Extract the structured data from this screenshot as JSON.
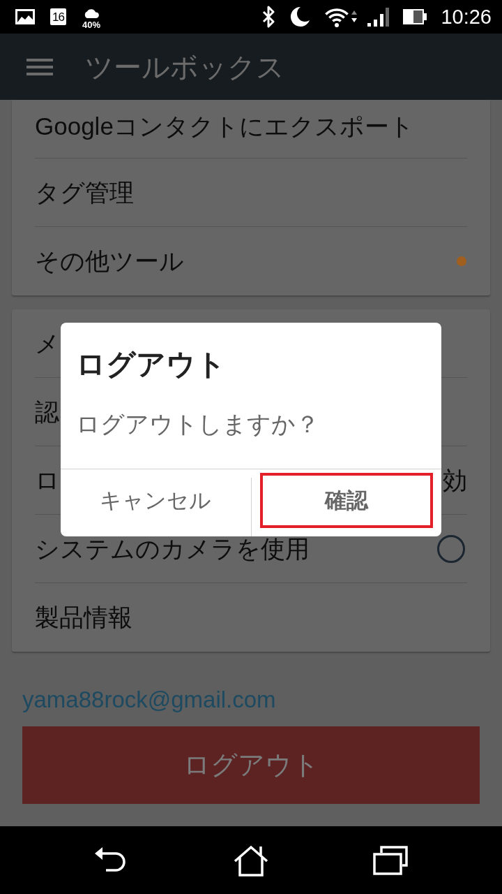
{
  "status_bar": {
    "calendar_day": "16",
    "precipitation": "40%",
    "time": "10:26"
  },
  "app_bar": {
    "title": "ツールボックス"
  },
  "cards": [
    {
      "items": [
        {
          "kind": "plain",
          "label": "Googleコンタクトにエクスポート"
        },
        {
          "kind": "plain",
          "label": "タグ管理"
        },
        {
          "kind": "dot",
          "label": "その他ツール",
          "color": "#a05f1e"
        }
      ]
    },
    {
      "items": [
        {
          "kind": "plain",
          "label": "メ"
        },
        {
          "kind": "plain",
          "label": "認"
        },
        {
          "kind": "value",
          "label": "ロ",
          "value": "効"
        },
        {
          "kind": "check",
          "label": "システムのカメラを使用",
          "checked": false
        },
        {
          "kind": "plain",
          "label": "製品情報"
        }
      ]
    }
  ],
  "account": {
    "email": "yama88rock@gmail.com",
    "logout_button": "ログアウト"
  },
  "dialog": {
    "title": "ログアウト",
    "message": "ログアウトしますか？",
    "buttons": [
      {
        "kind": "negative",
        "label": "キャンセル",
        "highlighted": false
      },
      {
        "kind": "positive",
        "label": "確認",
        "highlighted": true
      }
    ]
  }
}
